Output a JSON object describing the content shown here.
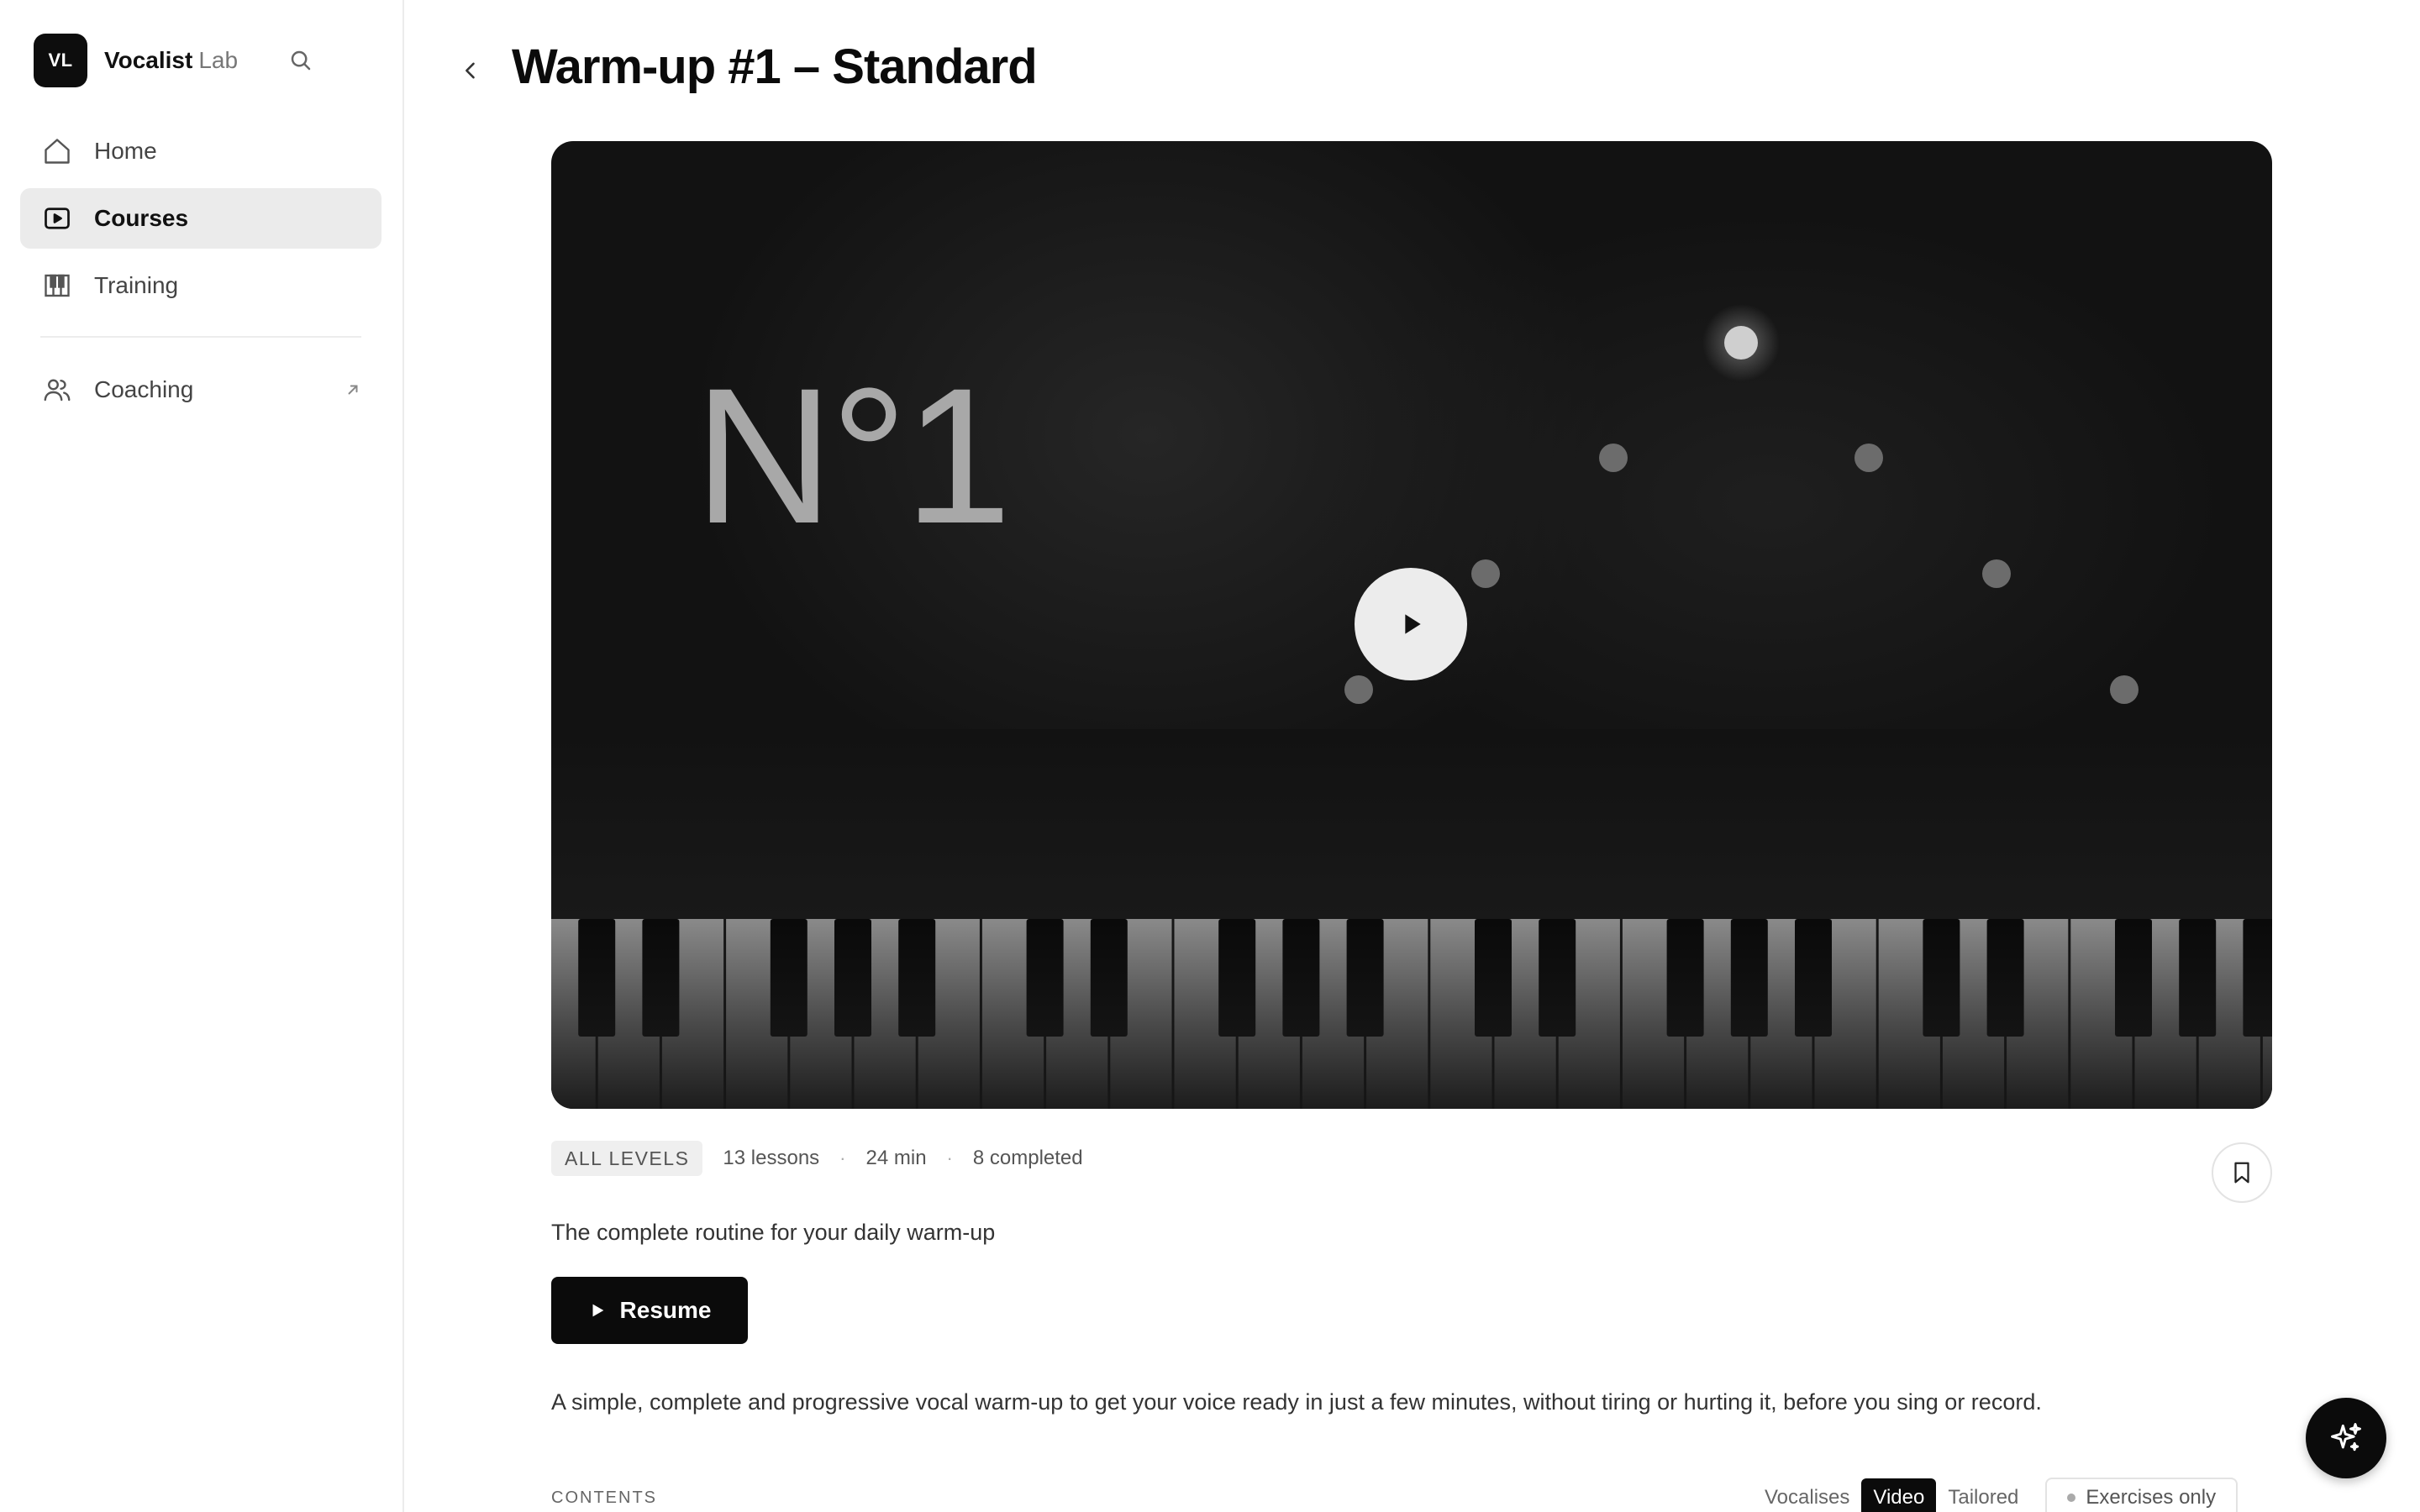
{
  "brand": {
    "logo_text": "VL",
    "name": "Vocalist",
    "suffix": "Lab"
  },
  "sidebar": {
    "items": [
      {
        "label": "Home",
        "icon": "home-icon",
        "active": false
      },
      {
        "label": "Courses",
        "icon": "video-play-icon",
        "active": true
      },
      {
        "label": "Training",
        "icon": "piano-keys-icon",
        "active": false
      },
      {
        "label": "Coaching",
        "icon": "users-icon",
        "active": false,
        "external": true
      }
    ]
  },
  "page": {
    "title": "Warm-up #1 – Standard"
  },
  "video": {
    "overlay_text": "N°1"
  },
  "course": {
    "level": "ALL LEVELS",
    "lessons": "13 lessons",
    "duration": "24 min",
    "completed": "8 completed",
    "subtitle": "The complete routine for your daily warm-up",
    "resume_label": "Resume",
    "description": "A simple, complete and progressive vocal warm-up to get your voice ready in just a few minutes, without tiring or hurting it, before you sing or record."
  },
  "contents": {
    "label": "CONTENTS",
    "tabs": [
      {
        "label": "Vocalises",
        "active": false
      },
      {
        "label": "Video",
        "active": true
      },
      {
        "label": "Tailored",
        "active": false
      }
    ],
    "filter_label": "Exercises only"
  },
  "colors": {
    "accent": "#0b0b0b",
    "active_nav_bg": "#ebebeb",
    "video_bg": "#121212"
  }
}
